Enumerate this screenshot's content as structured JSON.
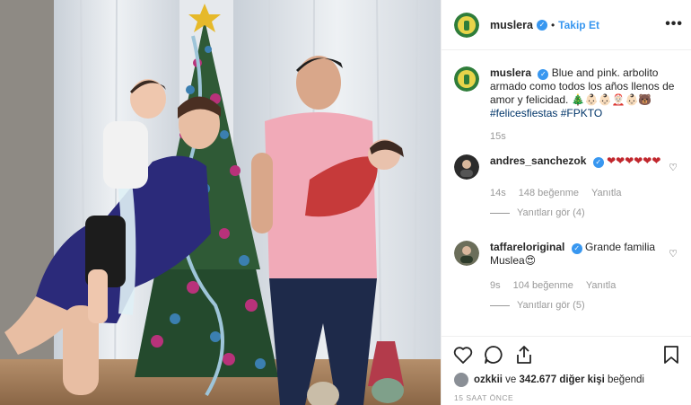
{
  "header": {
    "username": "muslera",
    "separator": "•",
    "follow_label": "Takip Et",
    "more_label": "•••"
  },
  "caption": {
    "username": "muslera",
    "text": "Blue and pink. arbolito armado como todos los años llenos de amor y felicidad. 🎄👶🏻👶🏻🤶🏻👶🏻🐻",
    "hashtags": "#felicesfiestas #FPKTO",
    "time": "15s"
  },
  "comments": [
    {
      "username": "andres_sanchezok",
      "text": "❤❤❤❤❤❤",
      "time": "14s",
      "likes": "148 beğenme",
      "reply": "Yanıtla",
      "view_replies": "Yanıtları gör (4)"
    },
    {
      "username": "taffareloriginal",
      "text": "Grande familia Muslea😍",
      "time": "9s",
      "likes": "104 beğenme",
      "reply": "Yanıtla",
      "view_replies": "Yanıtları gör (5)"
    }
  ],
  "likes": {
    "user": "ozkkii",
    "connector": "ve",
    "count": "342.677",
    "rest": "diğer kişi",
    "verb": "beğendi"
  },
  "timestamp": "15 SAAT ÖNCE",
  "colors": {
    "accent": "#3897f0",
    "text": "#262626",
    "muted": "#999999",
    "hashtag": "#003569",
    "divider": "#efefef"
  },
  "icons": [
    "verified-icon",
    "more-icon",
    "heart-icon",
    "comment-icon",
    "share-icon",
    "bookmark-icon"
  ]
}
